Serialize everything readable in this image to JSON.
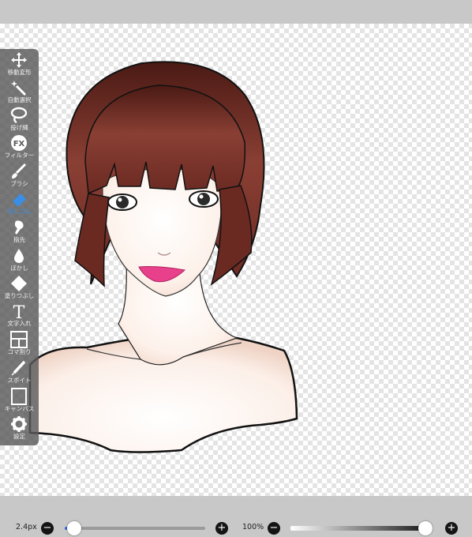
{
  "toolbar": {
    "items": [
      {
        "label": "移動変形",
        "icon": "move-arrows-icon"
      },
      {
        "label": "自動選択",
        "icon": "magic-wand-icon"
      },
      {
        "label": "投げ縄",
        "icon": "lasso-icon"
      },
      {
        "label": "フィルター",
        "icon": "fx-icon"
      },
      {
        "label": "ブラシ",
        "icon": "brush-icon"
      },
      {
        "label": "消しゴム",
        "icon": "eraser-icon"
      },
      {
        "label": "指先",
        "icon": "finger-smudge-icon"
      },
      {
        "label": "ぼかし",
        "icon": "blur-drop-icon"
      },
      {
        "label": "塗りつぶし",
        "icon": "fill-bucket-icon"
      },
      {
        "label": "文字入れ",
        "icon": "text-t-icon"
      },
      {
        "label": "コマ割り",
        "icon": "frame-divider-icon"
      },
      {
        "label": "スポイト",
        "icon": "eyedropper-icon"
      },
      {
        "label": "キャンバス",
        "icon": "canvas-icon"
      },
      {
        "label": "設定",
        "icon": "gear-icon"
      }
    ],
    "active": "消しゴム",
    "colors": {
      "bg": "#5a5a5a",
      "label": "#f2f2f2",
      "active_label": "#3a8ee6"
    }
  },
  "brush_size": {
    "value_label": "2.4px",
    "minus": "−",
    "plus": "+",
    "slider_value": 0.07
  },
  "opacity": {
    "value_label": "100%",
    "minus": "−",
    "plus": "+",
    "slider_value": 1.0
  }
}
